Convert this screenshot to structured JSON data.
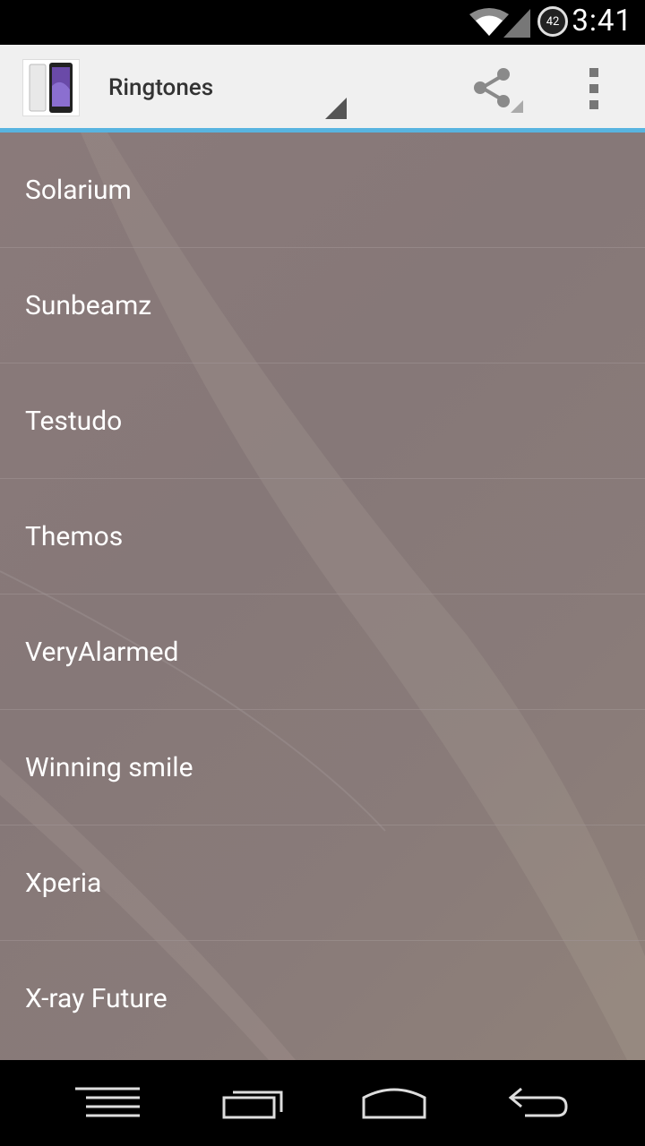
{
  "status_bar": {
    "time": "3:41",
    "battery": "42",
    "icons": [
      "wifi-icon",
      "signal-icon",
      "battery-icon"
    ]
  },
  "action_bar": {
    "title": "Ringtones",
    "icons": [
      "app-icon",
      "share-icon",
      "overflow-menu-icon"
    ],
    "accent_color": "#58b4e0"
  },
  "list": {
    "items": [
      {
        "label": "Solarium"
      },
      {
        "label": "Sunbeamz"
      },
      {
        "label": "Testudo"
      },
      {
        "label": "Themos"
      },
      {
        "label": "VeryAlarmed"
      },
      {
        "label": "Winning smile"
      },
      {
        "label": "Xperia"
      },
      {
        "label": "X-ray Future"
      }
    ]
  },
  "nav_bar": {
    "buttons": [
      "menu-icon",
      "recent-apps-icon",
      "home-icon",
      "back-icon"
    ]
  }
}
